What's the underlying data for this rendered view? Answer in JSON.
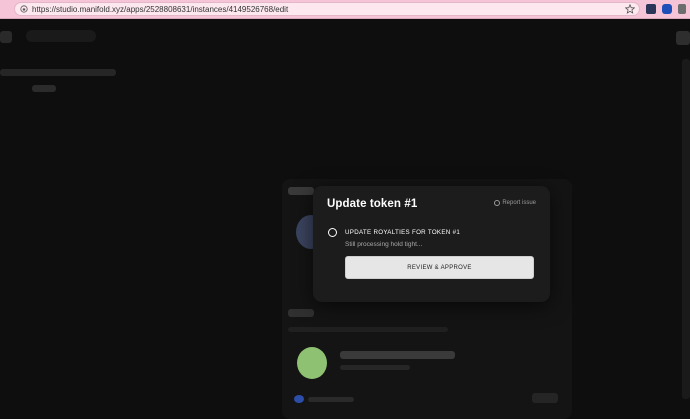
{
  "browser": {
    "url": "https://studio.manifold.xyz/apps/2528808631/instances/4149526768/edit"
  },
  "modal": {
    "title": "Update token #1",
    "report_label": "Report issue",
    "step": {
      "title": "UPDATE ROYALTIES FOR TOKEN #1",
      "status": "Still processing hold tight..."
    },
    "button_label": "REVIEW & APPROVE"
  },
  "colors": {
    "browser_bar": "#f6c4d7",
    "page_bg": "#0e0e0e",
    "modal_bg": "#1c1c1c",
    "button_bg": "#e6e6e6"
  }
}
